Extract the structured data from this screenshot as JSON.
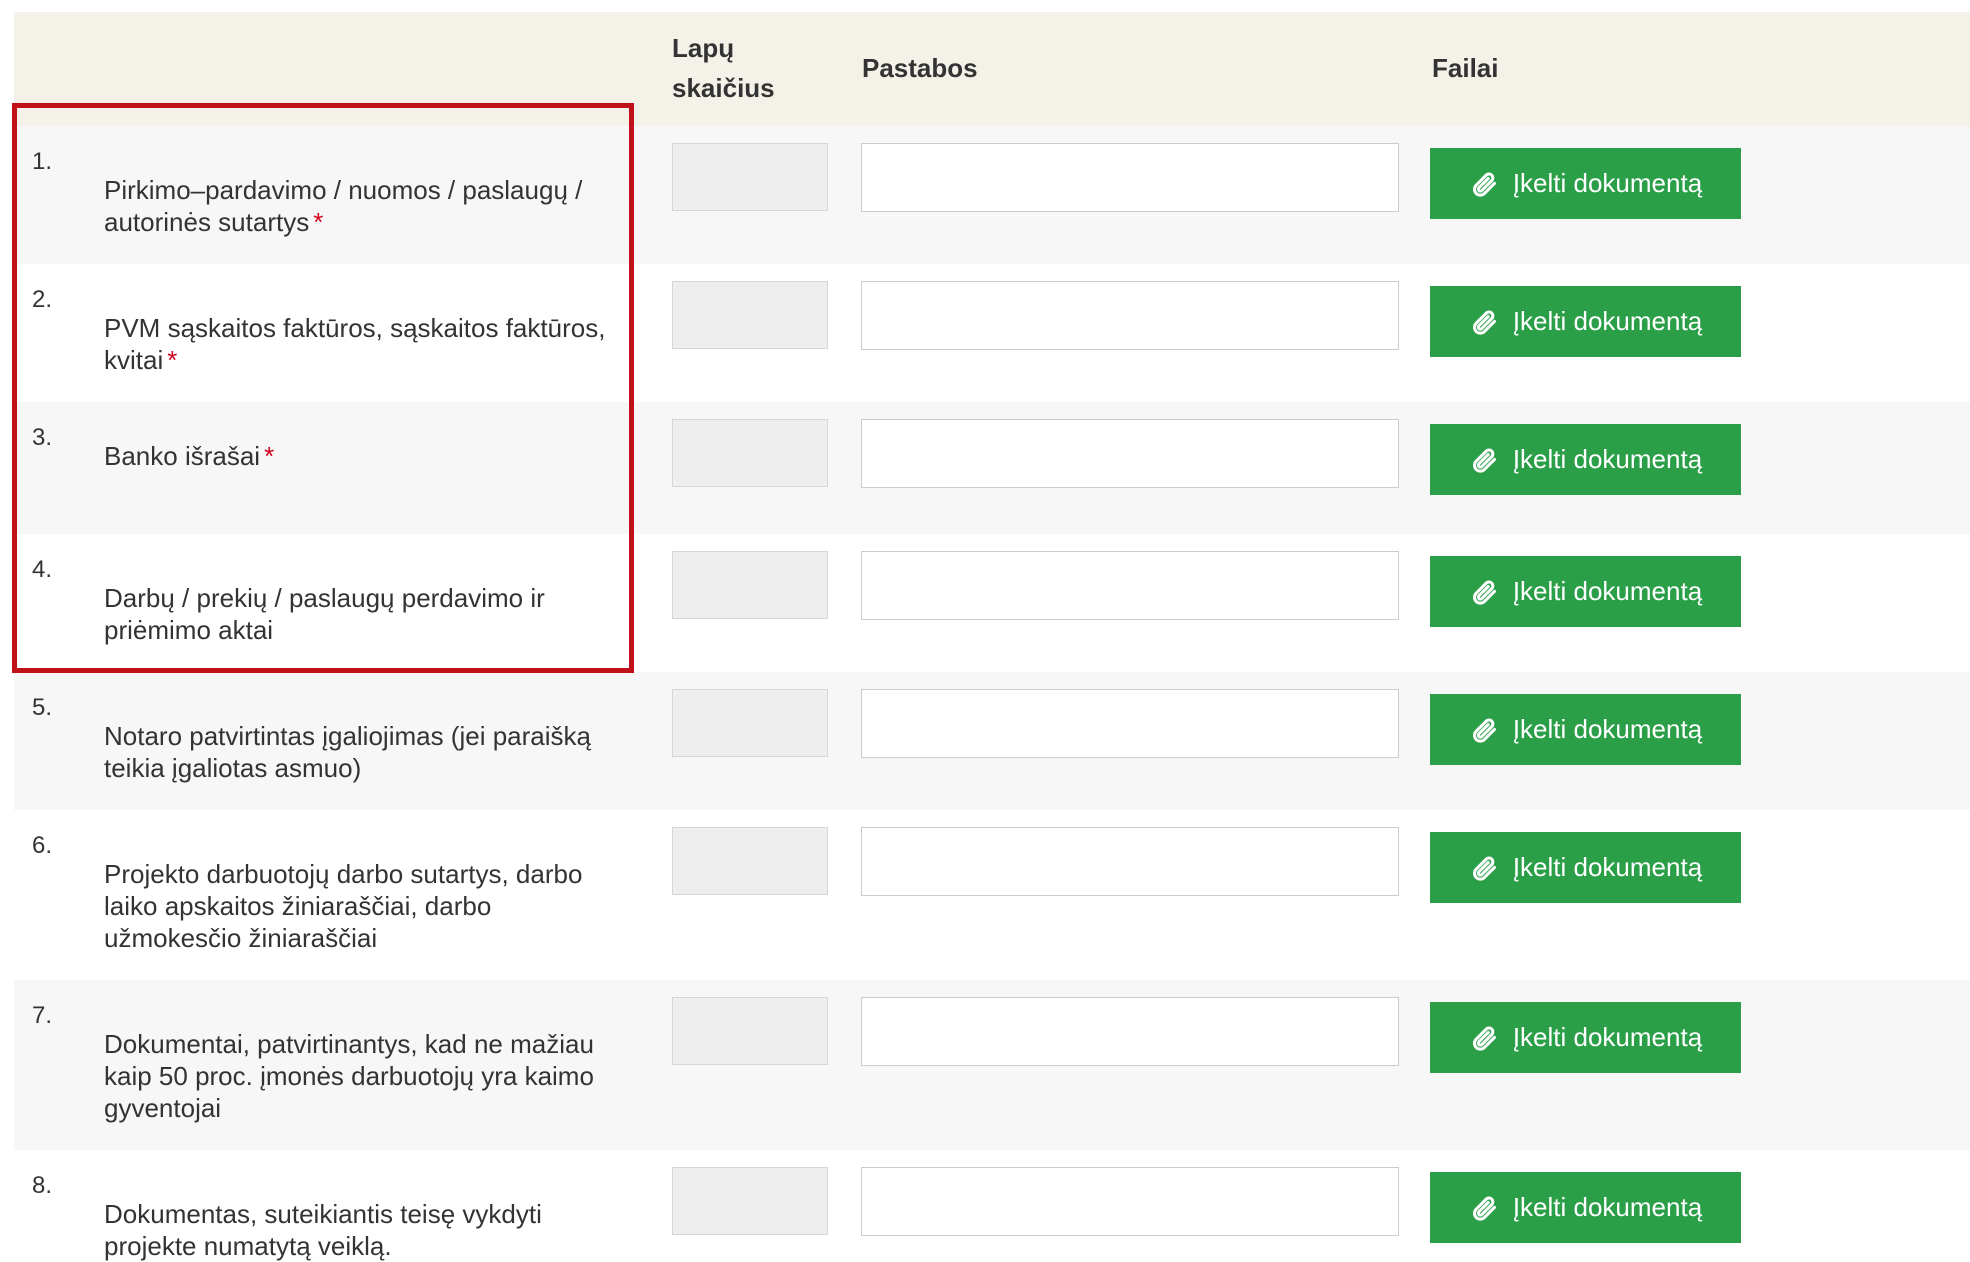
{
  "header": {
    "col_pages_line1": "Lapų",
    "col_pages_line2": "skaičius",
    "col_notes": "Pastabos",
    "col_files": "Failai"
  },
  "upload_label": "Įkelti dokumentą",
  "required_mark": "*",
  "colors": {
    "header_bg": "#f4f2e8",
    "row_alt_bg": "#f7f7f7",
    "button_green": "#2a9f48",
    "required_red": "#d0021b",
    "highlight_red": "#c0101a"
  },
  "rows": [
    {
      "num": "1.",
      "label": "Pirkimo–pardavimo / nuomos / paslaugų / autorinės sutartys",
      "required": true
    },
    {
      "num": "2.",
      "label": "PVM sąskaitos faktūros, sąskaitos faktūros, kvitai",
      "required": true
    },
    {
      "num": "3.",
      "label": "Banko išrašai",
      "required": true
    },
    {
      "num": "4.",
      "label": "Darbų / prekių / paslaugų perdavimo ir priėmimo aktai",
      "required": false
    },
    {
      "num": "5.",
      "label": "Notaro patvirtintas įgaliojimas (jei paraišką teikia įgaliotas asmuo)",
      "required": false
    },
    {
      "num": "6.",
      "label": "Projekto darbuotojų darbo sutartys, darbo laiko apskaitos žiniaraščiai, darbo užmokesčio žiniaraščiai",
      "required": false
    },
    {
      "num": "7.",
      "label": "Dokumentai, patvirtinantys, kad ne mažiau kaip 50 proc. įmonės darbuotojų yra kaimo gyventojai",
      "required": false
    },
    {
      "num": "8.",
      "label": "Dokumentas, suteikiantis teisę vykdyti projekte numatytą veiklą.",
      "required": false
    }
  ]
}
